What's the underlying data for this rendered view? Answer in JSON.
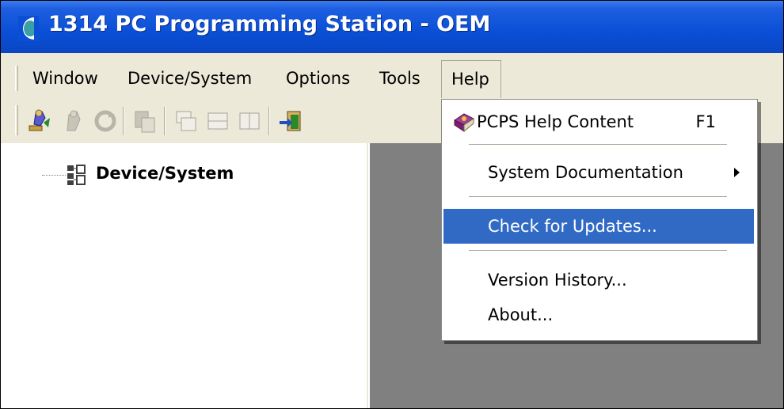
{
  "window": {
    "title": "1314 PC Programming Station - OEM",
    "titlebar_color": "#0a4fd6"
  },
  "menubar": {
    "items": [
      {
        "label": "Window"
      },
      {
        "label": "Device/System"
      },
      {
        "label": "Options"
      },
      {
        "label": "Tools"
      },
      {
        "label": "Help"
      }
    ],
    "open_menu": "Help"
  },
  "toolbar": {
    "buttons": [
      {
        "icon": "connect-icon",
        "enabled": true
      },
      {
        "icon": "disconnect-icon",
        "enabled": false
      },
      {
        "icon": "refresh-icon",
        "enabled": false
      },
      {
        "icon": "paste-icon",
        "enabled": false
      },
      {
        "icon": "cascade-windows-icon",
        "enabled": false
      },
      {
        "icon": "tile-horizontal-icon",
        "enabled": false
      },
      {
        "icon": "tile-vertical-icon",
        "enabled": false
      },
      {
        "icon": "exit-icon",
        "enabled": true
      }
    ]
  },
  "tree": {
    "root": {
      "label": "Device/System",
      "icon": "network-tree-icon"
    }
  },
  "help_menu": {
    "items": [
      {
        "label": "PCPS Help Content",
        "shortcut": "F1",
        "icon": "help-book-icon"
      },
      {
        "label": "System Documentation",
        "submenu": true
      },
      {
        "label": "Check for Updates...",
        "highlighted": true
      },
      {
        "label": "Version History..."
      },
      {
        "label": "About..."
      }
    ],
    "highlight_color": "#316ac5"
  },
  "colors": {
    "face": "#ece9d8",
    "workspace": "#808080"
  }
}
